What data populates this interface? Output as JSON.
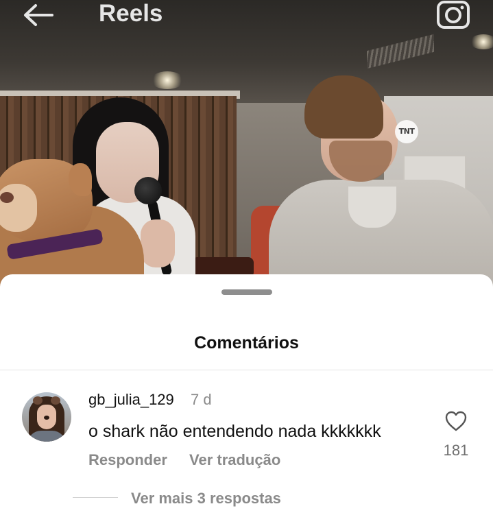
{
  "header": {
    "title": "Reels",
    "back_icon": "arrow-left-icon",
    "camera_icon": "camera-icon"
  },
  "video": {
    "watermark": "TNT"
  },
  "comments_sheet": {
    "title": "Comentários",
    "comments": [
      {
        "username": "gb_julia_129",
        "time": "7 d",
        "text": "o shark não entendendo nada kkkkkkk",
        "reply_label": "Responder",
        "translate_label": "Ver tradução",
        "like_icon": "heart-icon",
        "like_count": "181",
        "more_replies_label": "Ver mais 3 respostas"
      }
    ]
  },
  "colors": {
    "text_primary": "#111111",
    "text_secondary": "#8a8a8a",
    "sheet_background": "#ffffff",
    "handle": "#8e8e8e"
  }
}
